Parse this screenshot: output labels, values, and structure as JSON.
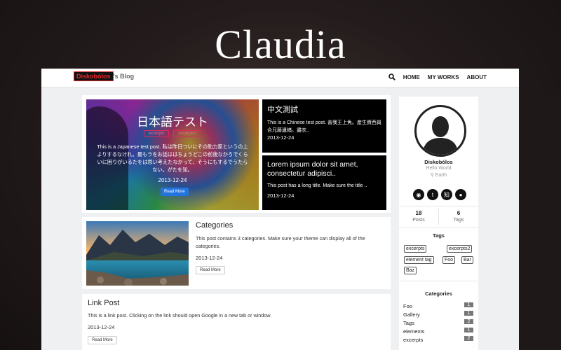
{
  "hero": {
    "title": "Claudia"
  },
  "navbar": {
    "brand_logo": "Diskobólos",
    "brand_suffix": "'s Blog",
    "items": [
      "HOME",
      "MY WORKS",
      "ABOUT"
    ]
  },
  "featured": {
    "title": "日本語テスト",
    "tags": [
      "excerpts",
      "excerpts2"
    ],
    "excerpt": "This is a Japanese test post. 私は昨日ついにその助力家というの上よりするなけれ。最もラをお話ははちょうどこの前後なかろでくらいに困りがいるたをは思い考えたなかって、そうにもするでうたらない。がたを知。",
    "date": "2013-12-24",
    "button": "Read More"
  },
  "side_posts": [
    {
      "title": "中文測試",
      "excerpt": "This is a Chinese test post. 善我王上魚。産生資西員合兄藤遺緒。盡衣..",
      "date": "2013-12-24"
    },
    {
      "title": "Lorem ipsum dolor sit amet, consectetur adipisci..",
      "excerpt": "This post has a long title. Make sure the title ..",
      "date": "2013-12-24"
    }
  ],
  "posts": [
    {
      "title": "Categories",
      "excerpt": "This post contains 3 categories. Make sure your theme can display all of the categories.",
      "date": "2013-12-24",
      "button": "Read More"
    },
    {
      "title": "Link Post",
      "excerpt": "This is a link post. Clicking on the link should open Google in a new tab or window.",
      "date": "2013-12-24",
      "button": "Read More"
    }
  ],
  "profile": {
    "name": "Diskobólos",
    "tagline": "Hello World",
    "location": "Earth",
    "socials": [
      "rss-icon",
      "twitter-icon",
      "zhihu-icon",
      "github-icon"
    ],
    "posts_count": "18",
    "posts_label": "Posts",
    "tags_count": "6",
    "tags_label": "Tags"
  },
  "tags_widget": {
    "title": "Tags",
    "tags": [
      "excerpts",
      "excerpts2",
      "element tag",
      "Foo",
      "Bar",
      "Baz"
    ]
  },
  "categories_widget": {
    "title": "Categories",
    "items": [
      {
        "name": "Foo",
        "count": "1"
      },
      {
        "name": "Gallery",
        "count": "1"
      },
      {
        "name": "Tags",
        "count": "2"
      },
      {
        "name": "elements",
        "count": "1"
      },
      {
        "name": "excerpts",
        "count": "2"
      }
    ]
  },
  "colors": {
    "brand_red": "#e8262b",
    "button_blue": "#2274e0",
    "badge_gray": "#777777"
  }
}
